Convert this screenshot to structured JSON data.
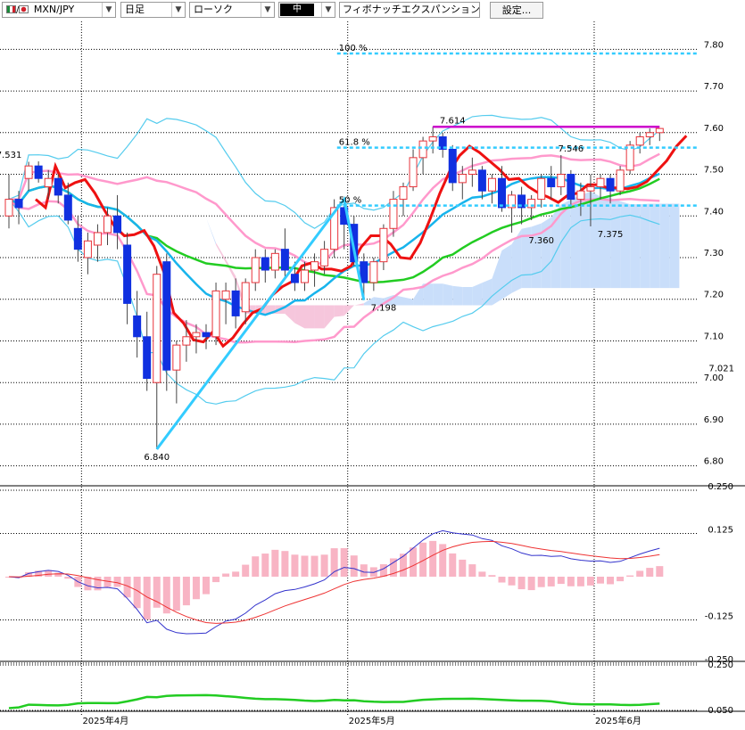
{
  "toolbar": {
    "pair": "MXN/JPY",
    "timeframe": "日足",
    "chart_style": "ローソク",
    "size": "中",
    "indicator": "フィボナッチエクスパンション",
    "settings_label": "設定..."
  },
  "colors": {
    "up_candle": "#e8333a",
    "down_candle": "#1030e0",
    "fast_line": "#ee1111",
    "green_line": "#22cc22",
    "cyan_line": "#18b4ec",
    "bollinger_outer": "#55ccee",
    "bollinger_inner": "#ff99cc",
    "fib_line": "#33ccff",
    "high_line": "#cc00cc",
    "cloud_bull": "#c9defa",
    "cloud_bear": "#f6c6dc",
    "macd_line": "#3333cc",
    "signal_line": "#ee3333",
    "histogram": "#f8b4c4"
  },
  "chart_data": [
    {
      "type": "line",
      "name": "price",
      "ylim": [
        6.78,
        7.82
      ],
      "yticks": [
        "7.80",
        "7.70",
        "7.60",
        "7.50",
        "7.40",
        "7.30",
        "7.20",
        "7.10",
        "7.00",
        "6.90",
        "6.80"
      ],
      "current_price_label": "7.021",
      "xtick_labels": [
        "2025年4月",
        "2025年5月",
        "2025年6月"
      ],
      "fib_labels": [
        "100 %",
        "61.8 %",
        "50 %"
      ],
      "fib_levels": [
        7.79,
        7.564,
        7.425
      ],
      "high_line_level": 7.614,
      "annotations": [
        {
          "label": "7.531",
          "bar": 0,
          "value": 7.531
        },
        {
          "label": "6.840",
          "bar": 15,
          "value": 6.84
        },
        {
          "label": "7.198",
          "bar": 38,
          "value": 7.198
        },
        {
          "label": "7.614",
          "bar": 45,
          "value": 7.614
        },
        {
          "label": "7.546",
          "bar": 57,
          "value": 7.546
        },
        {
          "label": "7.360",
          "bar": 54,
          "value": 7.36
        },
        {
          "label": "7.375",
          "bar": 61,
          "value": 7.375
        }
      ],
      "ohlc": [
        [
          7.4,
          7.5,
          7.37,
          7.44
        ],
        [
          7.44,
          7.46,
          7.38,
          7.42
        ],
        [
          7.49,
          7.53,
          7.46,
          7.52
        ],
        [
          7.52,
          7.531,
          7.48,
          7.49
        ],
        [
          7.47,
          7.51,
          7.44,
          7.49
        ],
        [
          7.49,
          7.5,
          7.43,
          7.45
        ],
        [
          7.45,
          7.48,
          7.38,
          7.39
        ],
        [
          7.37,
          7.4,
          7.29,
          7.32
        ],
        [
          7.3,
          7.36,
          7.26,
          7.34
        ],
        [
          7.33,
          7.38,
          7.29,
          7.36
        ],
        [
          7.36,
          7.42,
          7.33,
          7.4
        ],
        [
          7.4,
          7.45,
          7.32,
          7.36
        ],
        [
          7.33,
          7.36,
          7.14,
          7.19
        ],
        [
          7.16,
          7.22,
          7.06,
          7.11
        ],
        [
          7.11,
          7.17,
          6.98,
          7.01
        ],
        [
          7.0,
          7.28,
          6.84,
          7.26
        ],
        [
          7.29,
          7.31,
          6.98,
          7.03
        ],
        [
          7.03,
          7.1,
          6.95,
          7.09
        ],
        [
          7.09,
          7.15,
          7.05,
          7.11
        ],
        [
          7.11,
          7.14,
          7.07,
          7.12
        ],
        [
          7.12,
          7.14,
          7.08,
          7.11
        ],
        [
          7.11,
          7.24,
          7.09,
          7.22
        ],
        [
          7.2,
          7.24,
          7.14,
          7.22
        ],
        [
          7.22,
          7.25,
          7.13,
          7.16
        ],
        [
          7.17,
          7.25,
          7.14,
          7.24
        ],
        [
          7.24,
          7.32,
          7.22,
          7.3
        ],
        [
          7.3,
          7.32,
          7.24,
          7.27
        ],
        [
          7.27,
          7.32,
          7.25,
          7.31
        ],
        [
          7.32,
          7.37,
          7.25,
          7.27
        ],
        [
          7.26,
          7.29,
          7.22,
          7.24
        ],
        [
          7.24,
          7.29,
          7.22,
          7.27
        ],
        [
          7.27,
          7.31,
          7.23,
          7.29
        ],
        [
          7.28,
          7.34,
          7.26,
          7.32
        ],
        [
          7.32,
          7.44,
          7.3,
          7.42
        ],
        [
          7.42,
          7.44,
          7.32,
          7.38
        ],
        [
          7.38,
          7.4,
          7.28,
          7.29
        ],
        [
          7.29,
          7.31,
          7.198,
          7.24
        ],
        [
          7.24,
          7.3,
          7.22,
          7.29
        ],
        [
          7.29,
          7.38,
          7.27,
          7.37
        ],
        [
          7.37,
          7.46,
          7.35,
          7.44
        ],
        [
          7.44,
          7.48,
          7.4,
          7.47
        ],
        [
          7.47,
          7.56,
          7.46,
          7.54
        ],
        [
          7.54,
          7.59,
          7.5,
          7.58
        ],
        [
          7.58,
          7.614,
          7.55,
          7.59
        ],
        [
          7.59,
          7.6,
          7.54,
          7.56
        ],
        [
          7.56,
          7.57,
          7.46,
          7.48
        ],
        [
          7.48,
          7.52,
          7.44,
          7.5
        ],
        [
          7.5,
          7.54,
          7.47,
          7.51
        ],
        [
          7.51,
          7.52,
          7.44,
          7.46
        ],
        [
          7.46,
          7.5,
          7.43,
          7.49
        ],
        [
          7.49,
          7.52,
          7.41,
          7.42
        ],
        [
          7.42,
          7.46,
          7.36,
          7.45
        ],
        [
          7.45,
          7.47,
          7.38,
          7.42
        ],
        [
          7.42,
          7.45,
          7.39,
          7.44
        ],
        [
          7.44,
          7.5,
          7.42,
          7.49
        ],
        [
          7.49,
          7.52,
          7.44,
          7.47
        ],
        [
          7.47,
          7.546,
          7.45,
          7.5
        ],
        [
          7.5,
          7.51,
          7.42,
          7.44
        ],
        [
          7.44,
          7.48,
          7.4,
          7.46
        ],
        [
          7.46,
          7.5,
          7.375,
          7.47
        ],
        [
          7.47,
          7.5,
          7.44,
          7.49
        ],
        [
          7.49,
          7.5,
          7.43,
          7.46
        ],
        [
          7.46,
          7.52,
          7.45,
          7.51
        ],
        [
          7.51,
          7.58,
          7.5,
          7.57
        ],
        [
          7.57,
          7.6,
          7.55,
          7.59
        ],
        [
          7.59,
          7.61,
          7.57,
          7.6
        ],
        [
          7.6,
          7.61,
          7.58,
          7.61
        ]
      ]
    },
    {
      "type": "line",
      "name": "oscillator",
      "ylim": [
        -0.25,
        0.25
      ],
      "yticks": [
        "0.250",
        "0.125",
        "-0.125",
        "-0.250"
      ]
    },
    {
      "type": "line",
      "name": "lower-indicator",
      "ylim": [
        0.05,
        0.25
      ],
      "yticks": [
        "0.250",
        "0.050"
      ]
    }
  ]
}
